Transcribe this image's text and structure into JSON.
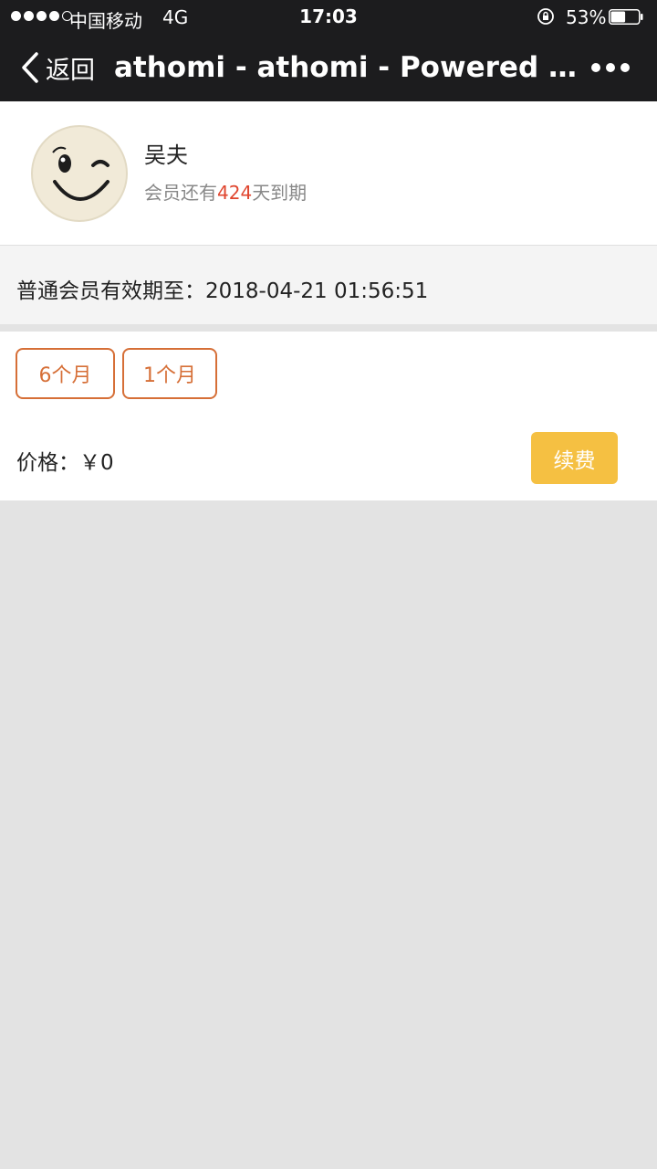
{
  "status_bar": {
    "carrier": "中国移动",
    "network": "4G",
    "time": "17:03",
    "battery": "53%",
    "battery_level": 0.53,
    "signal_bars": 4
  },
  "nav": {
    "back_label": "返回",
    "title": "athomi - athomi - Powered by W..."
  },
  "profile": {
    "name": "吴夫",
    "expiry_prefix": "会员还有",
    "expiry_days": "424",
    "expiry_suffix": "天到期"
  },
  "validity": {
    "label": "普通会员有效期至：",
    "date": "2018-04-21 01:56:51"
  },
  "plans": [
    {
      "label": "6个月"
    },
    {
      "label": "1个月"
    }
  ],
  "price": {
    "label": "价格：",
    "value": "￥0"
  },
  "renew_label": "续费",
  "colors": {
    "accent": "#d66f37",
    "renew": "#f5c042",
    "highlight": "#e0462f",
    "bar": "#1c1c1e"
  }
}
